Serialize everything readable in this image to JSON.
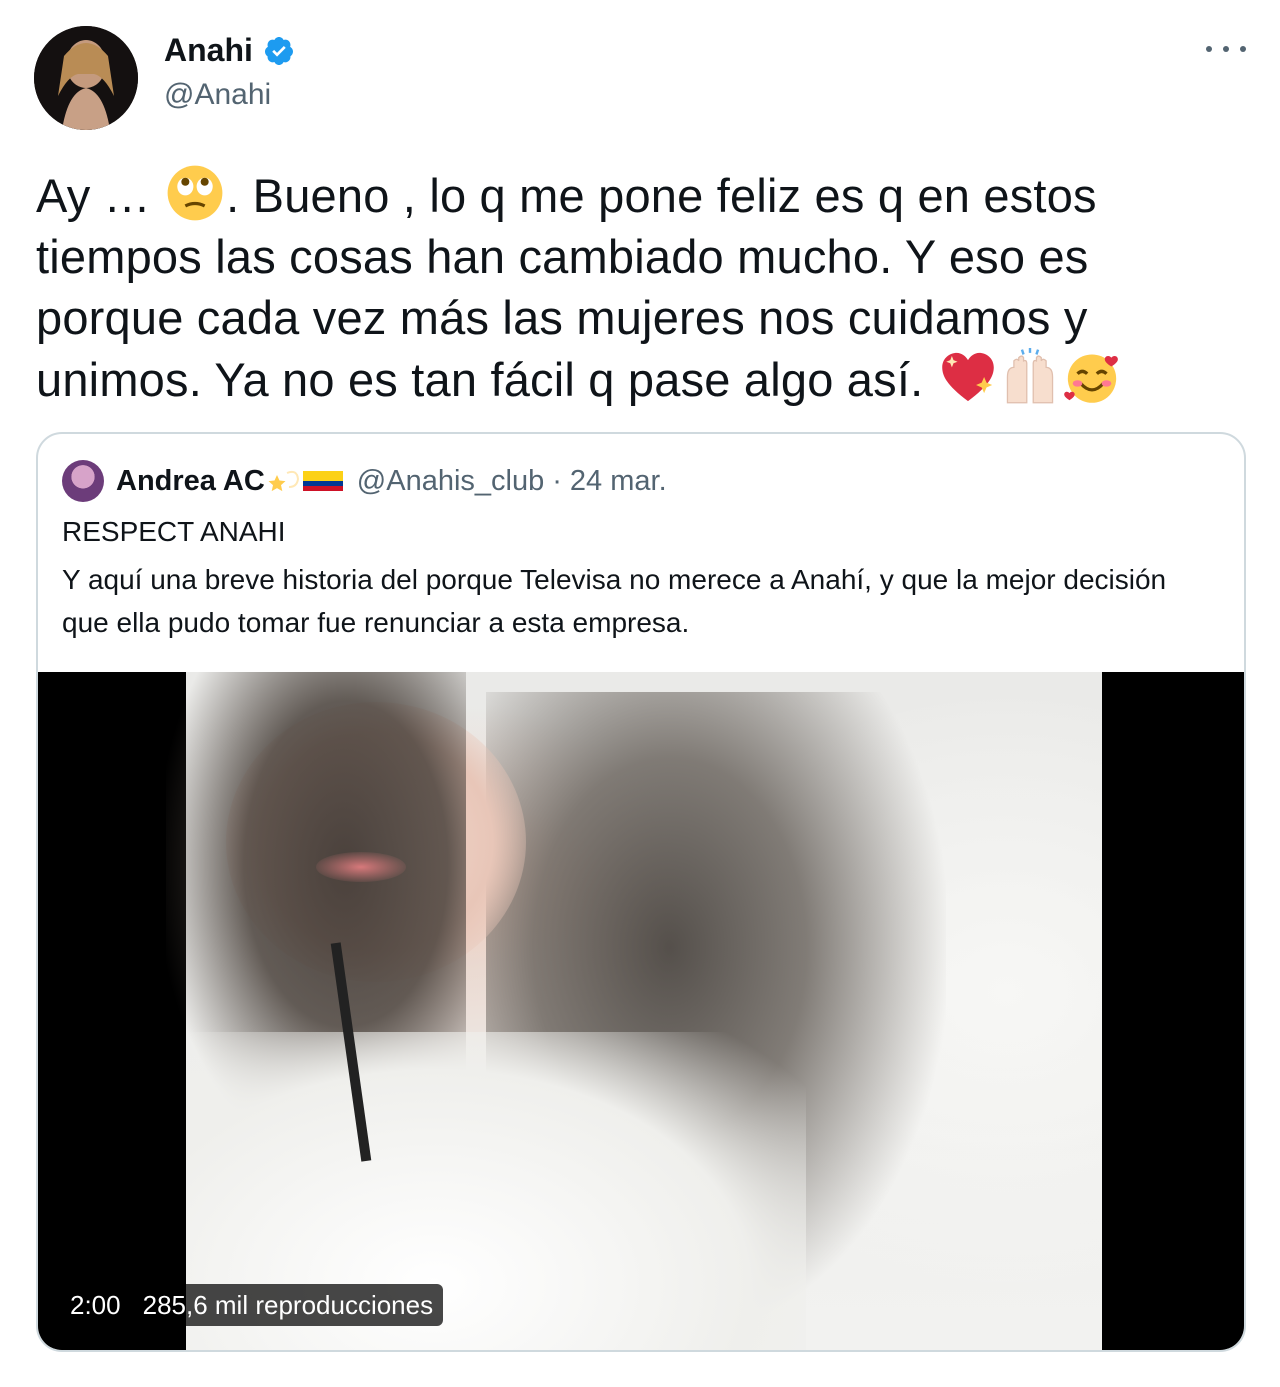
{
  "author": {
    "display_name": "Anahi",
    "handle": "@Anahi",
    "verified": true
  },
  "tweet": {
    "text_part1": "Ay … ",
    "text_part2": ". Bueno , lo q me pone feliz es q en estos tiempos las cosas han cambiado mucho. Y eso es porque cada vez más las mujeres nos cuidamos y unimos. Ya no es tan fácil q pase algo así. ",
    "emojis": [
      "face-with-rolling-eyes",
      "sparkling-heart",
      "raising-hands",
      "smiling-face-with-hearts"
    ]
  },
  "quoted": {
    "display_name": "Andrea AC",
    "badges": [
      "dizzy-star-emoji",
      "colombia-flag-emoji"
    ],
    "handle": "@Anahis_club",
    "separator": "·",
    "date": "24 mar.",
    "title": "RESPECT ANAHI",
    "body": "Y aquí una breve historia del porque Televisa no merece a Anahí, y que la mejor decisión que ella pudo tomar fue renunciar a esta empresa.",
    "video": {
      "duration": "2:00",
      "views": "285,6 mil reproducciones"
    }
  },
  "colors": {
    "text": "#0f1419",
    "secondary": "#536471",
    "verified_blue": "#1d9bf0",
    "border": "#cfd9de"
  }
}
